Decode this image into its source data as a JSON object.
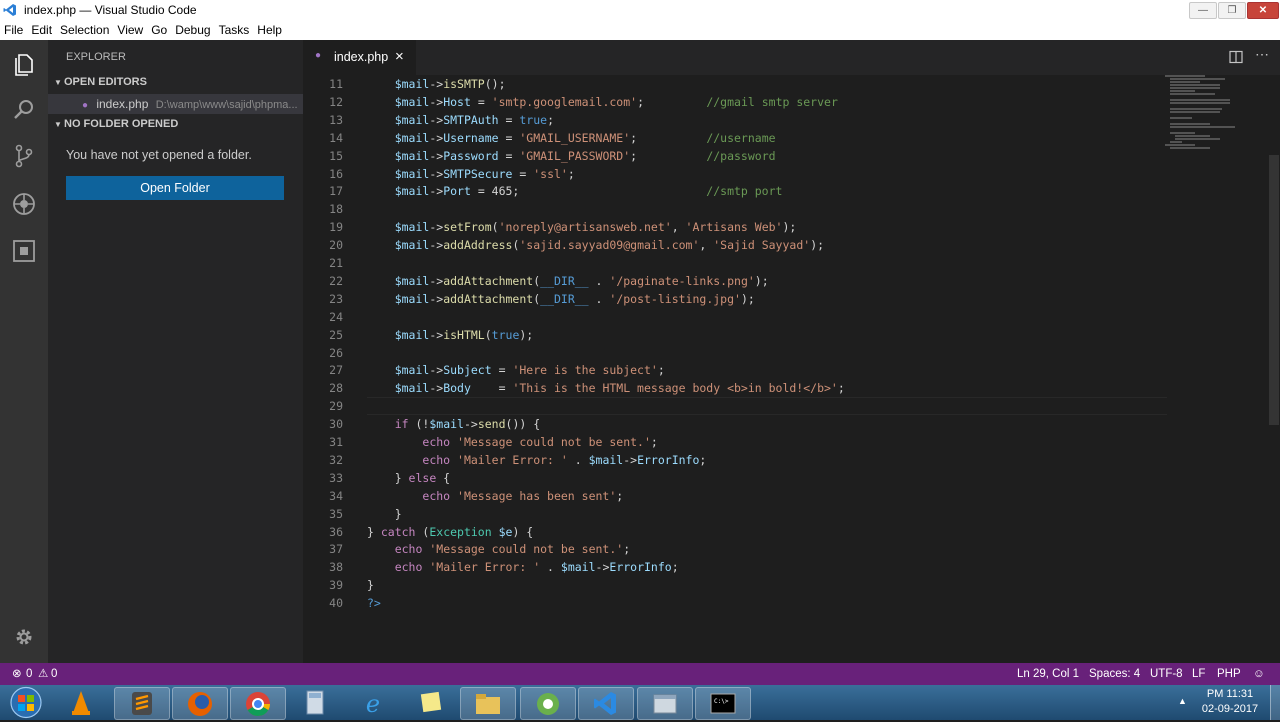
{
  "window": {
    "title": "index.php — Visual Studio Code",
    "controls": [
      "—",
      "❐",
      "✕"
    ]
  },
  "menu": [
    "File",
    "Edit",
    "Selection",
    "View",
    "Go",
    "Debug",
    "Tasks",
    "Help"
  ],
  "activity_bar": [
    "files-icon",
    "search-icon",
    "source-control-icon",
    "debug-icon",
    "extensions-icon",
    "gear-icon"
  ],
  "sidebar": {
    "header": "EXPLORER",
    "open_editors_label": "OPEN EDITORS",
    "open_editor_file": "index.php",
    "open_editor_path": "D:\\wamp\\www\\sajid\\phpma...",
    "no_folder_label": "NO FOLDER OPENED",
    "no_folder_message": "You have not yet opened a folder.",
    "open_folder_button": "Open Folder"
  },
  "tab": {
    "label": "index.php",
    "close": "×"
  },
  "editor": {
    "current_line": 29,
    "lines": [
      {
        "n": "11",
        "t": "    $mail->isSMTP();"
      },
      {
        "n": "12",
        "t": "    $mail->Host = 'smtp.googlemail.com';         //gmail smtp server"
      },
      {
        "n": "13",
        "t": "    $mail->SMTPAuth = true;"
      },
      {
        "n": "14",
        "t": "    $mail->Username = 'GMAIL_USERNAME';          //username"
      },
      {
        "n": "15",
        "t": "    $mail->Password = 'GMAIL_PASSWORD';          //password"
      },
      {
        "n": "16",
        "t": "    $mail->SMTPSecure = 'ssl';"
      },
      {
        "n": "17",
        "t": "    $mail->Port = 465;                           //smtp port"
      },
      {
        "n": "18",
        "t": ""
      },
      {
        "n": "19",
        "t": "    $mail->setFrom('noreply@artisansweb.net', 'Artisans Web');"
      },
      {
        "n": "20",
        "t": "    $mail->addAddress('sajid.sayyad09@gmail.com', 'Sajid Sayyad');"
      },
      {
        "n": "21",
        "t": ""
      },
      {
        "n": "22",
        "t": "    $mail->addAttachment(__DIR__ . '/paginate-links.png');"
      },
      {
        "n": "23",
        "t": "    $mail->addAttachment(__DIR__ . '/post-listing.jpg');"
      },
      {
        "n": "24",
        "t": ""
      },
      {
        "n": "25",
        "t": "    $mail->isHTML(true);"
      },
      {
        "n": "26",
        "t": ""
      },
      {
        "n": "27",
        "t": "    $mail->Subject = 'Here is the subject';"
      },
      {
        "n": "28",
        "t": "    $mail->Body    = 'This is the HTML message body <b>in bold!</b>';"
      },
      {
        "n": "29",
        "t": ""
      },
      {
        "n": "30",
        "t": "    if (!$mail->send()) {"
      },
      {
        "n": "31",
        "t": "        echo 'Message could not be sent.';"
      },
      {
        "n": "32",
        "t": "        echo 'Mailer Error: ' . $mail->ErrorInfo;"
      },
      {
        "n": "33",
        "t": "    } else {"
      },
      {
        "n": "34",
        "t": "        echo 'Message has been sent';"
      },
      {
        "n": "35",
        "t": "    }"
      },
      {
        "n": "36",
        "t": "} catch (Exception $e) {"
      },
      {
        "n": "37",
        "t": "    echo 'Message could not be sent.';"
      },
      {
        "n": "38",
        "t": "    echo 'Mailer Error: ' . $mail->ErrorInfo;"
      },
      {
        "n": "39",
        "t": "}"
      },
      {
        "n": "40",
        "t": "?>"
      }
    ]
  },
  "status": {
    "errors": "0",
    "warnings": "0",
    "position": "Ln 29, Col 1",
    "spaces": "Spaces: 4",
    "encoding": "UTF-8",
    "eol": "LF",
    "language": "PHP"
  },
  "taskbar": {
    "items": [
      "start-button",
      "vlc-icon",
      "sublime-text-icon",
      "firefox-icon",
      "chrome-icon",
      "calculator-icon",
      "internet-explorer-icon",
      "sticky-notes-icon",
      "file-explorer-icon",
      "camtasia-icon",
      "vscode-icon",
      "folder-window-icon",
      "cmd-icon"
    ],
    "time": "PM 11:31",
    "date": "02-09-2017"
  },
  "colors": {
    "statusbar": "#68217a",
    "button": "#0e639c",
    "sidebar": "#252526",
    "editor": "#1e1e1e"
  }
}
